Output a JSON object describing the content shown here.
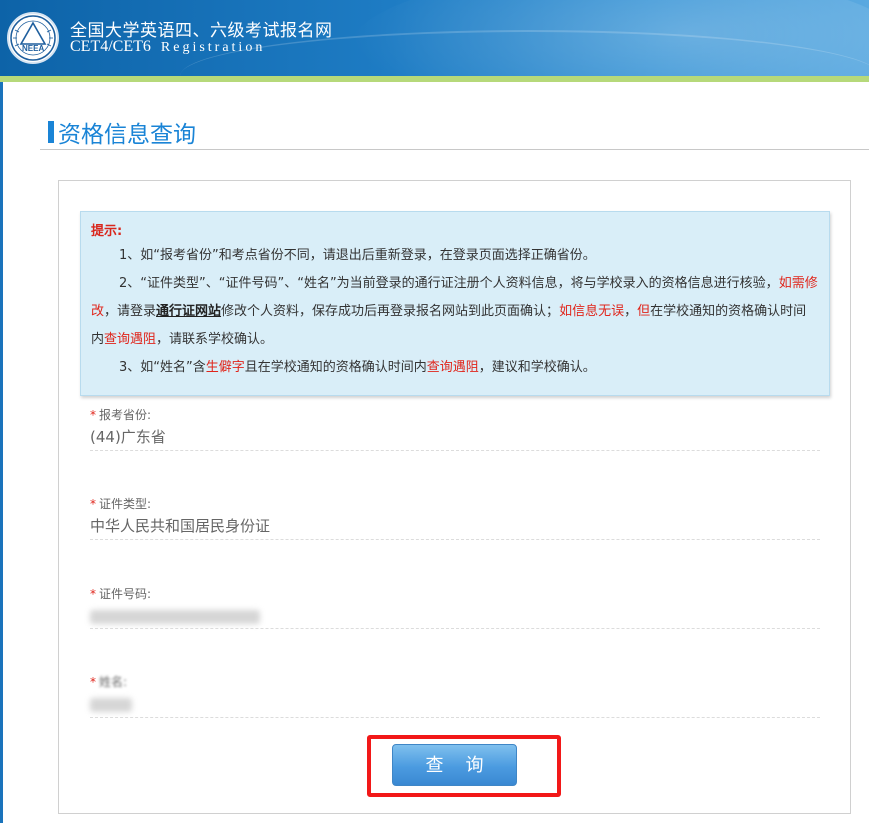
{
  "header": {
    "title_cn": "全国大学英语四、六级考试报名网",
    "title_en": "CET4/CET6",
    "title_en_sub": "Registration",
    "logo_text": "NEEA"
  },
  "page_title": "资格信息查询",
  "notice": {
    "label": "提示:",
    "item1": "1、如“报考省份”和考点省份不同，请退出后重新登录，在登录页面选择正确省份。",
    "item2_a": "2、“证件类型”、“证件号码”、“姓名”为当前登录的通行证注册个人资料信息，将与学校录入的资格信息进行核验，",
    "item2_b": "如需修改",
    "item2_c": "，请登录",
    "item2_link": "通行证网站",
    "item2_d": "修改个人资料，保存成功后再登录报名网站到此页面确认；",
    "item2_e": "如信息无误",
    "item2_f": "，",
    "item2_g": "但",
    "item2_h": "在学校通知的资格确认时间内",
    "item2_i": "查询遇阻",
    "item2_j": "，请联系学校确认。",
    "item3_a": "3、如“姓名”含",
    "item3_b": "生僻字",
    "item3_c": "且在学校通知的资格确认时间内",
    "item3_d": "查询遇阻",
    "item3_e": "，建议和学校确认。"
  },
  "fields": [
    {
      "label": "报考省份:",
      "value": "(44)广东省"
    },
    {
      "label": "证件类型:",
      "value": "中华人民共和国居民身份证"
    },
    {
      "label": "证件号码:",
      "value": ""
    },
    {
      "label": "姓名:",
      "value": ""
    }
  ],
  "button": {
    "label": "查询"
  },
  "colors": {
    "accent": "#1a84d6",
    "warning": "#e0251b",
    "notice_bg": "#d9eef8",
    "highlight": "#f21818"
  }
}
